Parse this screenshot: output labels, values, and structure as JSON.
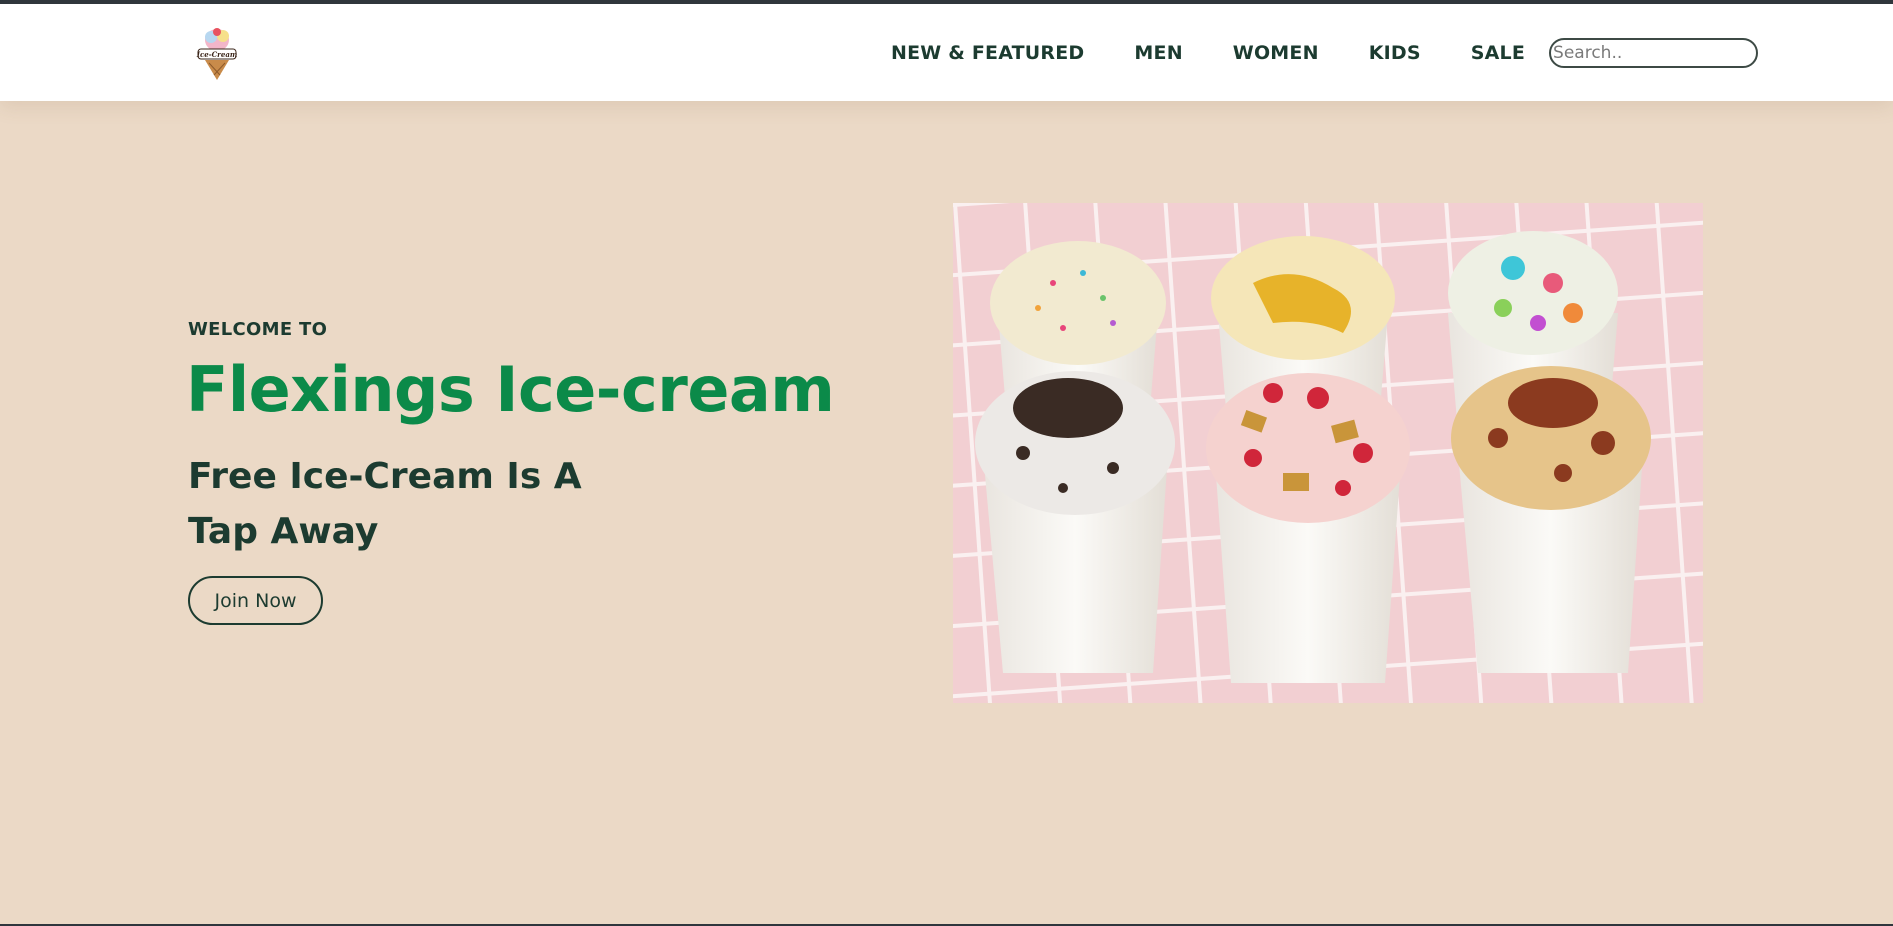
{
  "header": {
    "logo_text": "Ice-Cream",
    "nav": [
      "NEW & FEATURED",
      "MEN",
      "WOMEN",
      "KIDS",
      "SALE"
    ],
    "search_placeholder": "Search.."
  },
  "hero": {
    "welcome": "WELCOME TO",
    "title": "Flexings Ice-cream",
    "subtitle_line1": "Free Ice-Cream Is A",
    "subtitle_line2": "Tap Away",
    "cta": "Join Now"
  },
  "colors": {
    "background": "#ebd9c6",
    "title_green": "#0b8a49",
    "text_dark": "#1c3b30",
    "tile_pink": "#f2cfd2"
  }
}
